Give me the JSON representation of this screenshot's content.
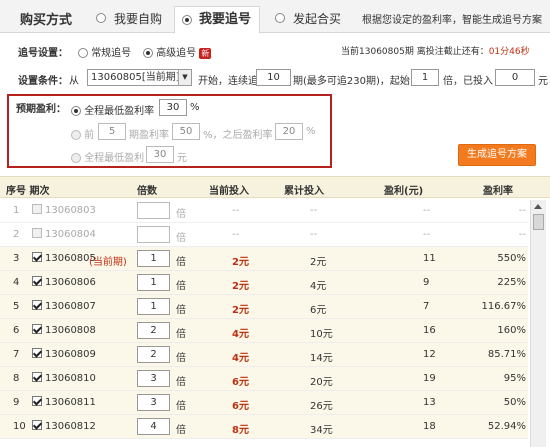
{
  "tabs": {
    "title": "购买方式",
    "items": [
      {
        "label": "我要自购"
      },
      {
        "label": "我要追号"
      },
      {
        "label": "发起合买"
      }
    ],
    "hint": "根据您设定的盈利率，智能生成追号方案"
  },
  "settings": {
    "label": "追号设置：",
    "normal": "常规追号",
    "advanced": "高级追号",
    "new_badge": "新",
    "deadline_prefix": "当前",
    "deadline_issue": "13060805",
    "deadline_mid": "期 离投注截止还有：",
    "deadline_time": "01分46秒"
  },
  "conditions": {
    "label": "设置条件：",
    "from": "从",
    "start_issue": "13060805[当前期]",
    "start_text": "开始，连续追",
    "count": "10",
    "count_text": "期(最多可追230期)，起始",
    "start_mult": "1",
    "mult_text": "倍，已投入",
    "invested": "0",
    "yuan": "元"
  },
  "preset": {
    "label": "预期盈利：",
    "opt1_label": "全程最低盈利率",
    "opt1_value": "30",
    "percent": "%",
    "opt2_before": "前",
    "opt2_issues": "5",
    "opt2_mid": "期盈利率",
    "opt2_rate1": "50",
    "opt2_after": "%，之后盈利率",
    "opt2_rate2": "20",
    "opt3_label": "全程最低盈利",
    "opt3_value": "30",
    "yuan": "元"
  },
  "generate_button": "生成追号方案",
  "table": {
    "headers": [
      "序号 期次",
      "倍数",
      "当前投入",
      "累计投入",
      "盈利(元)",
      "盈利率"
    ],
    "unit": "倍",
    "rows": [
      {
        "no": "1",
        "issue": "13060803",
        "checked": false,
        "disabled": true,
        "mult": "",
        "cur": "--",
        "total": "--",
        "profit": "--",
        "rate": "--"
      },
      {
        "no": "2",
        "issue": "13060804",
        "checked": false,
        "disabled": true,
        "mult": "",
        "cur": "--",
        "total": "--",
        "profit": "--",
        "rate": "--"
      },
      {
        "no": "3",
        "issue": "13060805",
        "tag": "(当前期)",
        "checked": true,
        "disabled": false,
        "mult": "1",
        "cur": "2元",
        "total": "2元",
        "profit": "11",
        "rate": "550%"
      },
      {
        "no": "4",
        "issue": "13060806",
        "checked": true,
        "disabled": false,
        "mult": "1",
        "cur": "2元",
        "total": "4元",
        "profit": "9",
        "rate": "225%"
      },
      {
        "no": "5",
        "issue": "13060807",
        "checked": true,
        "disabled": false,
        "mult": "1",
        "cur": "2元",
        "total": "6元",
        "profit": "7",
        "rate": "116.67%"
      },
      {
        "no": "6",
        "issue": "13060808",
        "checked": true,
        "disabled": false,
        "mult": "2",
        "cur": "4元",
        "total": "10元",
        "profit": "16",
        "rate": "160%"
      },
      {
        "no": "7",
        "issue": "13060809",
        "checked": true,
        "disabled": false,
        "mult": "2",
        "cur": "4元",
        "total": "14元",
        "profit": "12",
        "rate": "85.71%"
      },
      {
        "no": "8",
        "issue": "13060810",
        "checked": true,
        "disabled": false,
        "mult": "3",
        "cur": "6元",
        "total": "20元",
        "profit": "19",
        "rate": "95%"
      },
      {
        "no": "9",
        "issue": "13060811",
        "checked": true,
        "disabled": false,
        "mult": "3",
        "cur": "6元",
        "total": "26元",
        "profit": "13",
        "rate": "50%"
      },
      {
        "no": "10",
        "issue": "13060812",
        "checked": true,
        "disabled": false,
        "mult": "4",
        "cur": "8元",
        "total": "34元",
        "profit": "18",
        "rate": "52.94%"
      }
    ]
  }
}
